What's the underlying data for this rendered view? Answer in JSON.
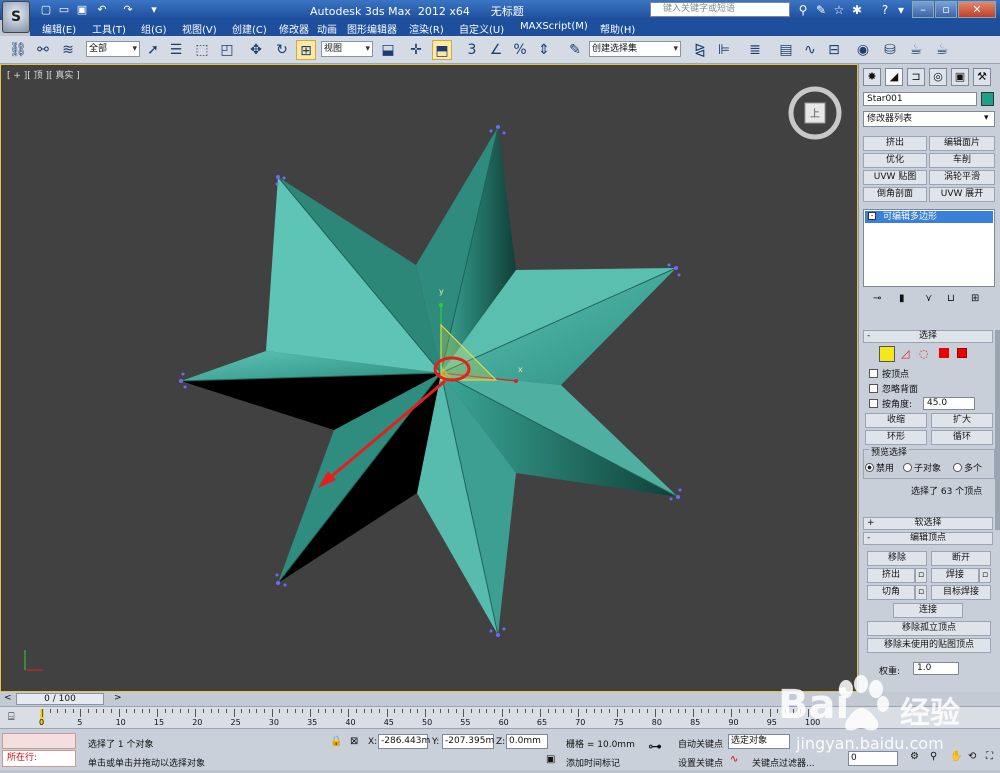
{
  "titlebar": {
    "title": "Autodesk 3ds Max  2012 x64      无标题",
    "help_search_placeholder": "键入关键字或短语",
    "window_buttons": [
      "–",
      "▫",
      "✕"
    ]
  },
  "menu": [
    "编辑(E)",
    "工具(T)",
    "组(G)",
    "视图(V)",
    "创建(C)",
    "修改器",
    "动画",
    "图形编辑器",
    "渲染(R)",
    "自定义(U)",
    "MAXScript(M)",
    "帮助(H)"
  ],
  "toolbar": {
    "selection_filter": "全部",
    "reference_coord": "视图",
    "named_selection": "创建选择集"
  },
  "viewport": {
    "label": "[ + ][ 顶 ][ 真实 ]",
    "gizmo_axis_x": "x",
    "gizmo_axis_y": "y",
    "viewcube_face": "上"
  },
  "command_panel": {
    "object_name": "Star001",
    "object_color": "#1fa086",
    "modifier_list": "修改器列表",
    "modifier_buttons": [
      [
        "挤出",
        "编辑面片"
      ],
      [
        "优化",
        "车削"
      ],
      [
        "UVW 贴图",
        "涡轮平滑"
      ],
      [
        "倒角剖面",
        "UVW 展开"
      ]
    ],
    "stack_item": "可编辑多边形",
    "selection": {
      "title": "选择",
      "by_vertex": "按顶点",
      "ignore_backfacing": "忽略背面",
      "by_angle": "按角度:",
      "angle_value": "45.0",
      "shrink": "收缩",
      "grow": "扩大",
      "ring": "环形",
      "loop": "循环",
      "preview_title": "预览选择",
      "preview_options": [
        "禁用",
        "子对象",
        "多个"
      ],
      "status": "选择了 63 个顶点"
    },
    "soft_selection": "软选择",
    "edit_vertices": {
      "title": "编辑顶点",
      "remove": "移除",
      "break": "断开",
      "extrude": "挤出",
      "weld": "焊接",
      "chamfer": "切角",
      "target_weld": "目标焊接",
      "connect": "连接",
      "remove_isolated": "移除孤立顶点",
      "remove_unused_map": "移除未使用的贴图顶点",
      "weight_label": "权重:",
      "weight_value": "1.0"
    }
  },
  "time_slider": {
    "frame": "0 / 100"
  },
  "timeline_ticks": [
    "0",
    "5",
    "10",
    "15",
    "20",
    "25",
    "30",
    "35",
    "40",
    "45",
    "50",
    "55",
    "60",
    "65",
    "70",
    "75",
    "80",
    "85",
    "90",
    "95",
    "100"
  ],
  "status": {
    "running_label": "所在行:",
    "selected_msg": "选择了 1 个对象",
    "prompt": "单击或单击并拖动以选择对象",
    "x_label": "X:",
    "x_value": "-286.443m",
    "y_label": "Y:",
    "y_value": "-207.395m",
    "z_label": "Z:",
    "z_value": "0.0mm",
    "grid": "栅格 = 10.0mm",
    "add_time_tag": "添加时间标记",
    "auto_key": "自动关键点",
    "selected_object": "选定对象",
    "set_key": "设置关键点",
    "key_filters": "关键点过滤器...",
    "frame_field": "0"
  },
  "watermark": {
    "brand": "Bai",
    "brand_cn": "经验",
    "url": "jingyan.baidu.com"
  }
}
